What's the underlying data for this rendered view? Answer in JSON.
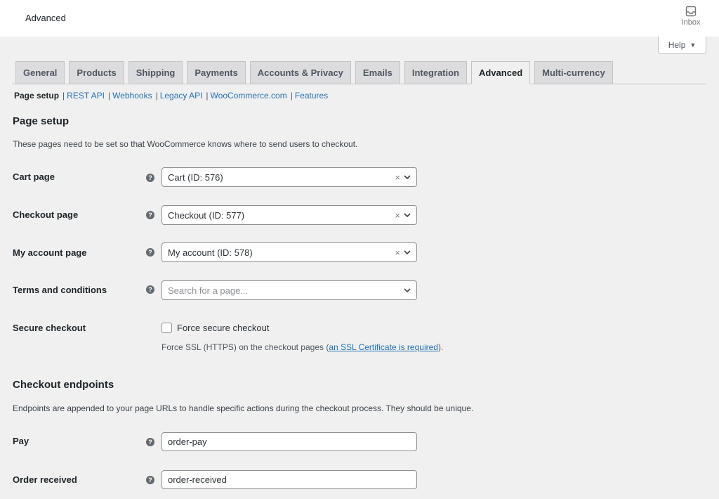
{
  "header": {
    "title": "Advanced",
    "inbox_label": "Inbox"
  },
  "help": {
    "label": "Help"
  },
  "tabs": [
    {
      "label": "General"
    },
    {
      "label": "Products"
    },
    {
      "label": "Shipping"
    },
    {
      "label": "Payments"
    },
    {
      "label": "Accounts & Privacy"
    },
    {
      "label": "Emails"
    },
    {
      "label": "Integration"
    },
    {
      "label": "Advanced",
      "active": true
    },
    {
      "label": "Multi-currency"
    }
  ],
  "subnav": [
    {
      "label": "Page setup",
      "current": true
    },
    {
      "label": "REST API"
    },
    {
      "label": "Webhooks"
    },
    {
      "label": "Legacy API"
    },
    {
      "label": "WooCommerce.com"
    },
    {
      "label": "Features"
    }
  ],
  "subnav_separator": "|",
  "page_setup": {
    "heading": "Page setup",
    "description": "These pages need to be set so that WooCommerce knows where to send users to checkout.",
    "cart": {
      "label": "Cart page",
      "value": "Cart (ID: 576)"
    },
    "checkout": {
      "label": "Checkout page",
      "value": "Checkout (ID: 577)"
    },
    "myaccount": {
      "label": "My account page",
      "value": "My account (ID: 578)"
    },
    "terms": {
      "label": "Terms and conditions",
      "placeholder": "Search for a page..."
    },
    "secure": {
      "label": "Secure checkout",
      "checkbox_label": "Force secure checkout",
      "checked": false,
      "help_prefix": "Force SSL (HTTPS) on the checkout pages (",
      "help_link": "an SSL Certificate is required",
      "help_suffix": ")."
    }
  },
  "endpoints": {
    "heading": "Checkout endpoints",
    "description": "Endpoints are appended to your page URLs to handle specific actions during the checkout process. They should be unique.",
    "pay": {
      "label": "Pay",
      "value": "order-pay"
    },
    "order_received": {
      "label": "Order received",
      "value": "order-received"
    }
  },
  "clear_glyph": "×",
  "help_glyph": "?"
}
